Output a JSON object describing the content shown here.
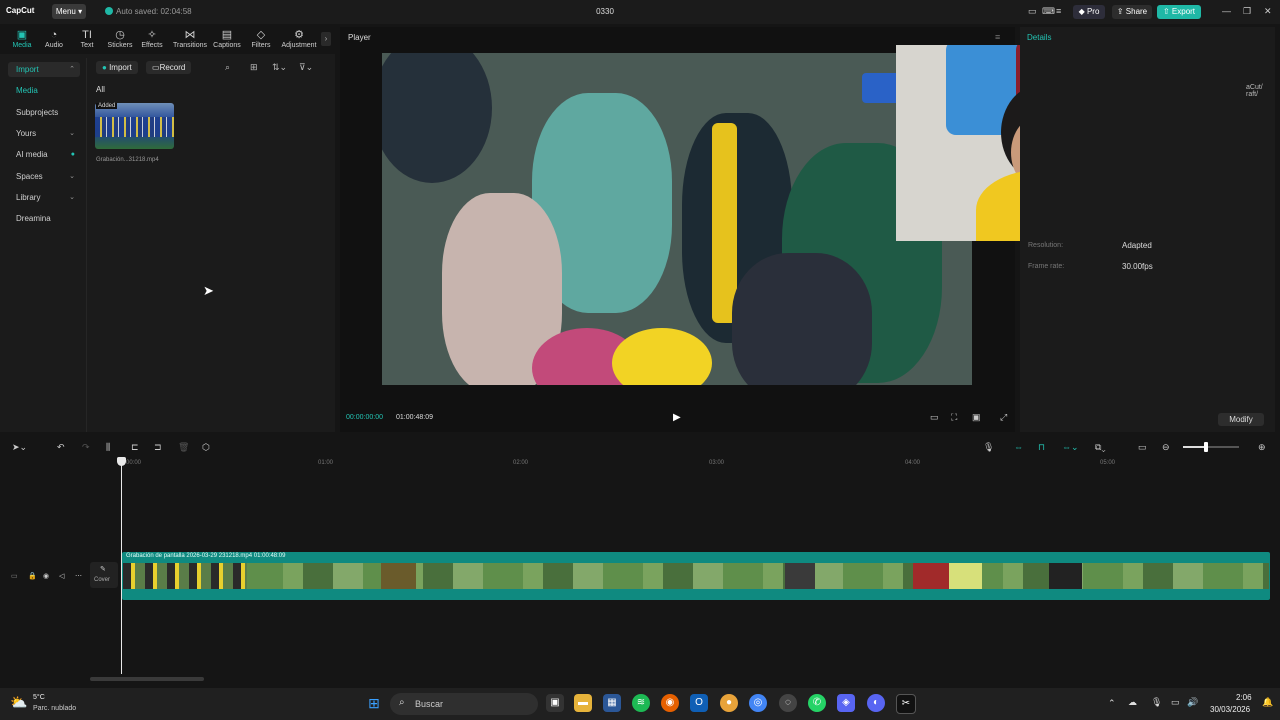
{
  "titlebar": {
    "app_name": "CapCut",
    "menu_label": "Menu",
    "autosave": "Auto saved: 02:04:58",
    "project_name": "0330",
    "pro_label": "Pro",
    "share_label": "Share",
    "export_label": "Export"
  },
  "toolbar": {
    "items": [
      "Media",
      "Audio",
      "Text",
      "Stickers",
      "Effects",
      "Transitions",
      "Captions",
      "Filters",
      "Adjustment"
    ]
  },
  "leftnav": {
    "items": [
      "Import",
      "Media",
      "Subprojects",
      "Yours",
      "AI media",
      "Spaces",
      "Library",
      "Dreamina"
    ]
  },
  "media": {
    "import_label": "Import",
    "record_label": "Record",
    "filter_all": "All",
    "added_badge": "Added",
    "clip_name": "Grabación...31218.mp4"
  },
  "player": {
    "title": "Player",
    "current_time": "00:00:00:00",
    "total_time": "01:00:48:09"
  },
  "details": {
    "title": "Details",
    "partial_right": "aCut/\nraft/",
    "rows": [
      {
        "label": "Resolution:",
        "value": "Adapted"
      },
      {
        "label": "Frame rate:",
        "value": "30.00fps"
      }
    ],
    "modify_label": "Modify"
  },
  "timeline": {
    "ticks": [
      "00:00",
      "01:00",
      "02:00",
      "03:00",
      "04:00",
      "05:00"
    ],
    "clip_label": "Grabación de pantalla 2026-03-29 231218.mp4   01:00:48:09",
    "cover_label": "Cover"
  },
  "taskbar": {
    "weather_temp": "5°C",
    "weather_desc": "Parc. nublado",
    "search_placeholder": "Buscar",
    "time": "2:06",
    "date": "30/03/2026"
  },
  "colors": {
    "accent": "#23c4b4",
    "track": "#0f8a80",
    "export": "#1fb8a6",
    "pro": "#3a3a5a"
  }
}
